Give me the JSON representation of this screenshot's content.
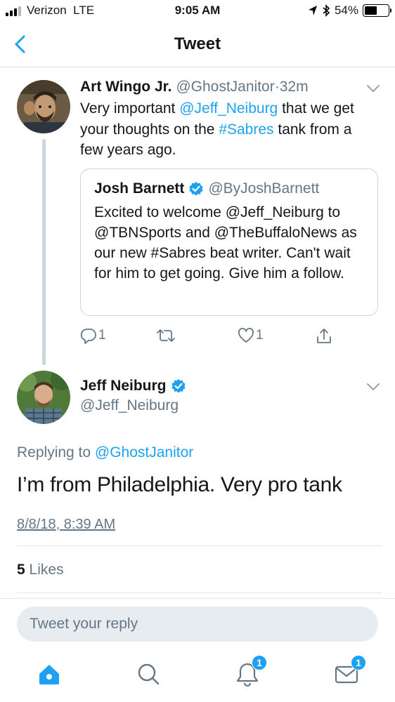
{
  "status_bar": {
    "carrier": "Verizon",
    "network": "LTE",
    "time": "9:05 AM",
    "battery": "54%",
    "battery_level": 0.54
  },
  "nav": {
    "title": "Tweet",
    "back_icon": "chevron-left-icon"
  },
  "colors": {
    "accent": "#1da1f2",
    "muted": "#657786",
    "text": "#14171a",
    "border": "#ccd6dd"
  },
  "tweet1": {
    "name": "Art Wingo Jr.",
    "handle": "@GhostJanitor",
    "sep": "·",
    "age": "32m",
    "text_1": "Very important ",
    "mention": "@Jeff_Neiburg",
    "text_2": " that we get your thoughts on the ",
    "hashtag": "#Sabres",
    "text_3": " tank from a few years ago.",
    "quote": {
      "name": "Josh Barnett",
      "handle": "@ByJoshBarnett",
      "text": "Excited to welcome @Jeff_Neiburg to @TBNSports and @TheBuffaloNews as our new #Sabres beat writer. Can't wait for him to get going. Give him a follow."
    },
    "actions": {
      "reply_count": "1",
      "retweet_count": "",
      "like_count": "1"
    }
  },
  "tweet2": {
    "name": "Jeff Neiburg",
    "handle": "@Jeff_Neiburg",
    "replying_prefix": "Replying to ",
    "replying_to": "@GhostJanitor",
    "text": "I’m from Philadelphia. Very pro tank",
    "date": "8/8/18, 8:39 AM",
    "likes_count": "5",
    "likes_label": " Likes"
  },
  "reply": {
    "placeholder": "Tweet your reply"
  },
  "tabbar": {
    "notifications_badge": "1",
    "messages_badge": "1"
  }
}
